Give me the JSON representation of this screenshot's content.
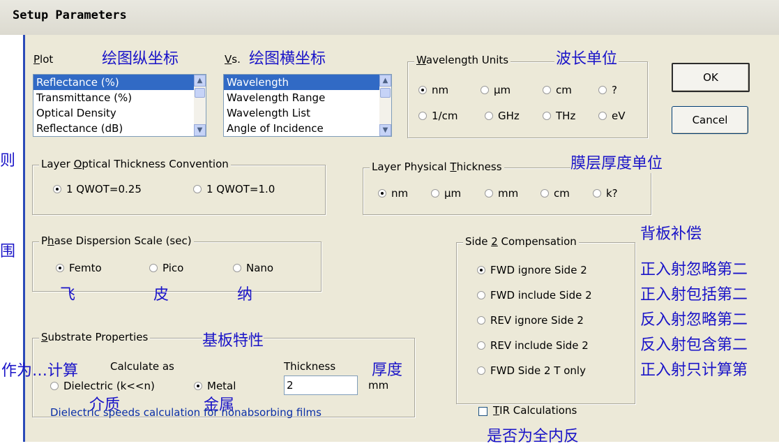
{
  "window": {
    "title": "Setup Parameters"
  },
  "plot": {
    "label": "Plot",
    "items": [
      "Reflectance (%)",
      "Transmittance (%)",
      "Optical Density",
      "Reflectance (dB)"
    ],
    "note": "绘图纵坐标"
  },
  "vs": {
    "label": "Vs.",
    "items": [
      "Wavelength",
      "Wavelength Range",
      "Wavelength List",
      "Angle of Incidence"
    ],
    "note": "绘图横坐标"
  },
  "wavelength_units": {
    "legend": "Wavelength Units",
    "note": "波长单位",
    "options": [
      "nm",
      "μm",
      "cm",
      "?",
      "1/cm",
      "GHz",
      "THz",
      "eV"
    ]
  },
  "buttons": {
    "ok": "OK",
    "cancel": "Cancel"
  },
  "optical_thickness": {
    "legend": "Layer Optical Thickness Convention",
    "options": [
      "1 QWOT=0.25",
      "1 QWOT=1.0"
    ],
    "side_note": "则"
  },
  "physical_thickness": {
    "legend": "Layer Physical Thickness",
    "note": "膜层厚度单位",
    "options": [
      "nm",
      "μm",
      "mm",
      "cm",
      "k?"
    ]
  },
  "phase_dispersion": {
    "legend": "Phase Dispersion Scale (sec)",
    "options": [
      "Femto",
      "Pico",
      "Nano"
    ],
    "notes": [
      "飞",
      "皮",
      "纳"
    ],
    "side_note": "围"
  },
  "side2": {
    "legend": "Side 2 Compensation",
    "note": "背板补偿",
    "options": [
      "FWD ignore Side 2",
      "FWD include Side 2",
      "REV ignore Side 2",
      "REV include Side 2",
      "FWD Side 2 T only"
    ],
    "notes": [
      "正入射忽略第二",
      "正入射包括第二",
      "反入射忽略第二",
      "反入射包含第二",
      "正入射只计算第"
    ]
  },
  "substrate": {
    "legend": "Substrate Properties",
    "note": "基板特性",
    "calc_as_label": "Calculate as",
    "calc_note": "作为…计算",
    "options": [
      "Dielectric (k<<n)",
      "Metal"
    ],
    "option_notes": [
      "介质",
      "金属"
    ],
    "thickness_label": "Thickness",
    "thickness_note": "厚度",
    "thickness_value": "2",
    "thickness_unit": "mm",
    "info": "Dielectric speeds calculation for nonabsorbing films"
  },
  "tir": {
    "label": "TIR Calculations",
    "note": "是否为全内反"
  },
  "colors": {
    "annotation": "#1a14c8",
    "selection": "#316ac5",
    "dialog": "#ece9d8"
  }
}
